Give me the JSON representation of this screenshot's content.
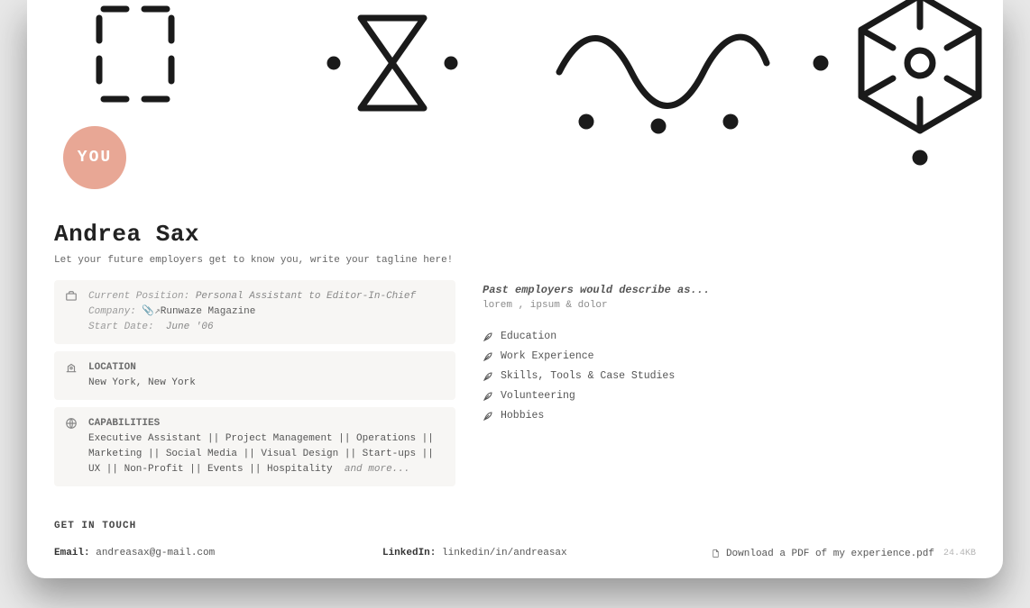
{
  "badge_text": "YOU",
  "title": "Andrea Sax",
  "tagline": "Let your future employers get to know you, write your tagline here!",
  "position_card": {
    "label_position": "Current Position:",
    "position": "Personal Assistant to Editor-In-Chief",
    "label_company": "Company:",
    "company": "Runwaze Magazine",
    "label_start": "Start Date:",
    "start": "June '06"
  },
  "location_card": {
    "heading": "LOCATION",
    "value": "New York, New York"
  },
  "capabilities_card": {
    "heading": "CAPABILITIES",
    "body": "Executive Assistant || Project Management || Operations || Marketing || Social Media || Visual Design || Start-ups || UX || Non-Profit || Events ||  Hospitality",
    "more": "and more..."
  },
  "describe": {
    "heading": "Past employers would describe as...",
    "body": "lorem , ipsum & dolor"
  },
  "pages": [
    "Education",
    "Work Experience",
    "Skills, Tools & Case Studies",
    "Volunteering",
    "Hobbies"
  ],
  "contact": {
    "heading": "GET IN TOUCH",
    "email_label": "Email:",
    "email": "andreasax@g-mail.com",
    "linkedin_label": "LinkedIn:",
    "linkedin": "linkedin/in/andreasax",
    "download": "Download a PDF of my experience.pdf",
    "size": "24.4KB"
  }
}
